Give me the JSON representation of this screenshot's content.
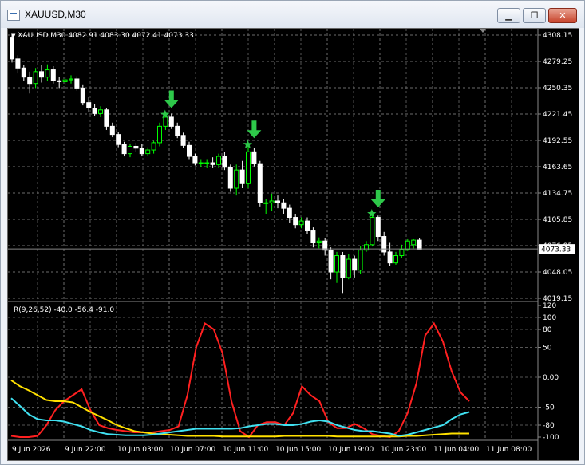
{
  "window": {
    "title": "XAUUSD,M30",
    "minimize_symbol": "▁",
    "restore_symbol": "❐",
    "close_symbol": "✕"
  },
  "main_chart": {
    "info_text": "XAUUSD,M30  4082.91 4083.30 4072.41 4073.33",
    "price_labels": [
      "4308.15",
      "4279.25",
      "4250.35",
      "4221.45",
      "4192.55",
      "4163.65",
      "4134.75",
      "4105.85",
      "4076.95",
      "4048.05",
      "4019.15"
    ],
    "current_price_label": "4073.33",
    "candle_up_color": "#00ff00",
    "candle_down_color": "#ffffff",
    "signal_color": "#2ec84a"
  },
  "indicator": {
    "info_text": "R(9,26,52) -40.0 -56.4 -91.0",
    "scale_labels": [
      "120",
      "100",
      "80",
      "50",
      "0.00",
      "-50",
      "-80",
      "-100"
    ],
    "line_colors": [
      "#ff2020",
      "#ffe000",
      "#40e0f0"
    ]
  },
  "time_axis": [
    "9 Jun 2026",
    "9 Jun 22:00",
    "10 Jun 03:00",
    "10 Jun 07:00",
    "10 Jun 11:00",
    "10 Jun 15:00",
    "10 Jun 19:00",
    "10 Jun 23:00",
    "11 Jun 04:00",
    "11 Jun 08:00"
  ],
  "chart_data": {
    "type": "candlestick",
    "timeframe": "M30",
    "symbol": "XAUUSD",
    "price_range": [
      4019.15,
      4308.15
    ],
    "candles": [
      [
        4305,
        4309,
        4278,
        4282
      ],
      [
        4282,
        4286,
        4266,
        4272
      ],
      [
        4272,
        4275,
        4258,
        4262
      ],
      [
        4262,
        4268,
        4244,
        4255
      ],
      [
        4255,
        4272,
        4250,
        4268
      ],
      [
        4268,
        4275,
        4256,
        4262
      ],
      [
        4262,
        4276,
        4258,
        4270
      ],
      [
        4270,
        4274,
        4255,
        4258
      ],
      [
        4258,
        4262,
        4250,
        4257
      ],
      [
        4257,
        4262,
        4254,
        4259
      ],
      [
        4259,
        4264,
        4255,
        4260
      ],
      [
        4260,
        4263,
        4247,
        4250
      ],
      [
        4250,
        4254,
        4231,
        4234
      ],
      [
        4234,
        4240,
        4224,
        4228
      ],
      [
        4228,
        4232,
        4219,
        4222
      ],
      [
        4222,
        4230,
        4218,
        4226
      ],
      [
        4226,
        4228,
        4204,
        4208
      ],
      [
        4208,
        4212,
        4196,
        4199
      ],
      [
        4199,
        4202,
        4185,
        4188
      ],
      [
        4188,
        4191,
        4175,
        4178
      ],
      [
        4178,
        4189,
        4174,
        4186
      ],
      [
        4186,
        4190,
        4180,
        4184
      ],
      [
        4184,
        4189,
        4175,
        4178
      ],
      [
        4178,
        4185,
        4175,
        4182
      ],
      [
        4182,
        4192,
        4178,
        4190
      ],
      [
        4190,
        4212,
        4186,
        4208
      ],
      [
        4208,
        4224,
        4204,
        4218
      ],
      [
        4218,
        4222,
        4205,
        4208
      ],
      [
        4208,
        4212,
        4195,
        4198
      ],
      [
        4198,
        4201,
        4184,
        4187
      ],
      [
        4187,
        4191,
        4172,
        4175
      ],
      [
        4175,
        4178,
        4165,
        4168
      ],
      [
        4168,
        4172,
        4163,
        4168
      ],
      [
        4168,
        4172,
        4162,
        4168
      ],
      [
        4168,
        4174,
        4162,
        4166
      ],
      [
        4166,
        4178,
        4162,
        4175
      ],
      [
        4175,
        4180,
        4160,
        4163
      ],
      [
        4163,
        4166,
        4136,
        4140
      ],
      [
        4140,
        4166,
        4132,
        4160
      ],
      [
        4160,
        4170,
        4140,
        4145
      ],
      [
        4145,
        4187,
        4140,
        4180
      ],
      [
        4180,
        4184,
        4164,
        4167
      ],
      [
        4167,
        4170,
        4120,
        4124
      ],
      [
        4124,
        4128,
        4112,
        4124
      ],
      [
        4124,
        4134,
        4115,
        4126
      ],
      [
        4126,
        4132,
        4118,
        4124
      ],
      [
        4124,
        4128,
        4112,
        4118
      ],
      [
        4118,
        4122,
        4102,
        4108
      ],
      [
        4108,
        4112,
        4096,
        4100
      ],
      [
        4100,
        4108,
        4096,
        4104
      ],
      [
        4104,
        4108,
        4090,
        4094
      ],
      [
        4094,
        4097,
        4075,
        4080
      ],
      [
        4080,
        4086,
        4074,
        4082
      ],
      [
        4082,
        4085,
        4066,
        4072
      ],
      [
        4072,
        4075,
        4040,
        4048
      ],
      [
        4048,
        4070,
        4036,
        4066
      ],
      [
        4066,
        4070,
        4025,
        4042
      ],
      [
        4042,
        4068,
        4040,
        4062
      ],
      [
        4062,
        4066,
        4042,
        4050
      ],
      [
        4050,
        4076,
        4046,
        4072
      ],
      [
        4072,
        4082,
        4070,
        4078
      ],
      [
        4078,
        4114,
        4076,
        4108
      ],
      [
        4108,
        4110,
        4082,
        4087
      ],
      [
        4087,
        4092,
        4066,
        4070
      ],
      [
        4070,
        4080,
        4055,
        4058
      ],
      [
        4058,
        4070,
        4056,
        4066
      ],
      [
        4066,
        4078,
        4063,
        4073
      ],
      [
        4073,
        4084,
        4071,
        4082
      ],
      [
        4078,
        4084,
        4074,
        4083
      ],
      [
        4083,
        4085,
        4072,
        4073
      ]
    ],
    "signals": [
      {
        "candle": 27,
        "price": 4221,
        "type": "sell"
      },
      {
        "candle": 41,
        "price": 4188,
        "type": "sell"
      },
      {
        "candle": 62,
        "price": 4112,
        "type": "sell"
      }
    ],
    "indicator": {
      "name": "R(9,26,52)",
      "range": [
        -100,
        120
      ],
      "series": [
        {
          "color": "#ff2020",
          "values": [
            -98,
            -100,
            -100,
            -98,
            -80,
            -55,
            -40,
            -30,
            -20,
            -55,
            -80,
            -85,
            -88,
            -90,
            -92,
            -92,
            -92,
            -90,
            -88,
            -82,
            -30,
            50,
            90,
            80,
            40,
            -40,
            -90,
            -100,
            -80,
            -75,
            -75,
            -80,
            -60,
            -15,
            -30,
            -40,
            -75,
            -85,
            -85,
            -78,
            -85,
            -95,
            -98,
            -100,
            -90,
            -60,
            -10,
            70,
            90,
            60,
            10,
            -25,
            -40
          ]
        },
        {
          "color": "#ffe000",
          "values": [
            -5,
            -15,
            -22,
            -30,
            -38,
            -40,
            -40,
            -42,
            -50,
            -58,
            -65,
            -72,
            -80,
            -85,
            -90,
            -92,
            -94,
            -95,
            -96,
            -97,
            -98,
            -98,
            -98,
            -98,
            -99,
            -99,
            -99,
            -99,
            -99,
            -99,
            -99,
            -98,
            -98,
            -98,
            -98,
            -98,
            -98,
            -99,
            -99,
            -99,
            -99,
            -99,
            -99,
            -99,
            -99,
            -98,
            -98,
            -97,
            -96,
            -95,
            -94,
            -94,
            -94
          ]
        },
        {
          "color": "#40e0f0",
          "values": [
            -35,
            -48,
            -62,
            -70,
            -72,
            -72,
            -74,
            -78,
            -82,
            -88,
            -92,
            -95,
            -96,
            -97,
            -97,
            -97,
            -96,
            -94,
            -92,
            -90,
            -88,
            -86,
            -86,
            -86,
            -86,
            -86,
            -85,
            -82,
            -80,
            -78,
            -78,
            -80,
            -80,
            -78,
            -74,
            -72,
            -74,
            -80,
            -84,
            -88,
            -90,
            -90,
            -92,
            -94,
            -98,
            -96,
            -92,
            -88,
            -84,
            -80,
            -70,
            -62,
            -58
          ]
        }
      ]
    }
  }
}
